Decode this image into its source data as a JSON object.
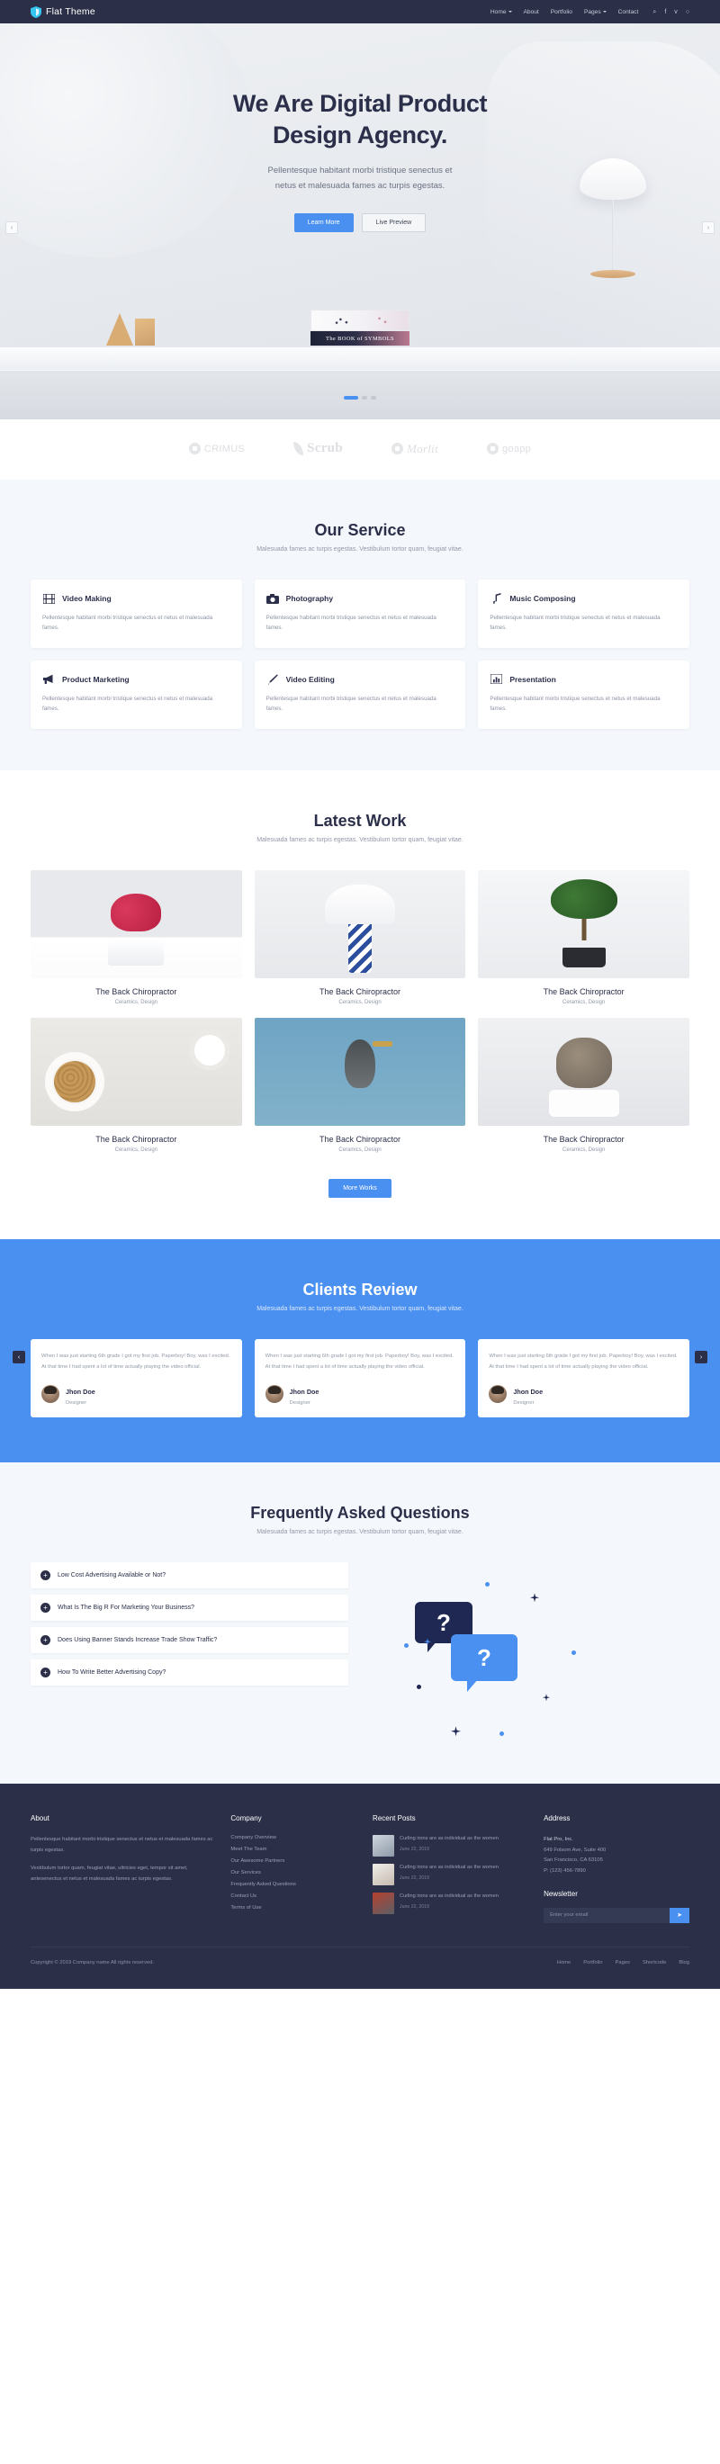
{
  "nav": {
    "brand": "Flat Theme",
    "brand_icon": "shield-icon",
    "links": [
      {
        "label": "Home",
        "caret": true
      },
      {
        "label": "About",
        "caret": false
      },
      {
        "label": "Portfolio",
        "caret": false
      },
      {
        "label": "Pages",
        "caret": true
      },
      {
        "label": "Contact",
        "caret": false
      }
    ],
    "icons": [
      {
        "name": "search-icon",
        "glyph": "⌕"
      },
      {
        "name": "facebook-icon",
        "glyph": "f"
      },
      {
        "name": "twitter-icon",
        "glyph": "ᴠ"
      },
      {
        "name": "github-icon",
        "glyph": "○"
      }
    ]
  },
  "hero": {
    "title_line1": "We Are Digital Product",
    "title_line2": "Design Agency.",
    "subtitle_line1": "Pellentesque habitant morbi tristique senectus et",
    "subtitle_line2": "netus et malesuada fames ac turpis egestas.",
    "primary_btn": "Learn More",
    "secondary_btn": "Live Preview",
    "prev_arrow": "‹",
    "next_arrow": "›",
    "book_title": "The BOOK of SYMBOLS"
  },
  "clients": [
    {
      "name": "CRIMUS",
      "mark": "circle-logo-icon"
    },
    {
      "name": "Scrub",
      "mark": "feather-logo-icon"
    },
    {
      "name": "Morlit",
      "mark": "m-logo-icon"
    },
    {
      "name": "goapp",
      "mark": "play-logo-icon"
    }
  ],
  "services": {
    "title": "Our Service",
    "subtitle": "Malesuada fames ac turpis egestas. Vestibulum tortor quam, feugiat vitae.",
    "items": [
      {
        "icon": "film-icon",
        "name": "Video Making",
        "desc": "Pellentesque habitant morbi tristique senectus et netus et malesuada fames."
      },
      {
        "icon": "camera-icon",
        "name": "Photography",
        "desc": "Pellentesque habitant morbi tristique senectus et netus et malesuada fames."
      },
      {
        "icon": "music-note-icon",
        "name": "Music Composing",
        "desc": "Pellentesque habitant morbi tristique senectus et netus et malesuada fames."
      },
      {
        "icon": "megaphone-icon",
        "name": "Product Marketing",
        "desc": "Pellentesque habitant morbi tristique senectus et netus et malesuada fames."
      },
      {
        "icon": "pen-icon",
        "name": "Video Editing",
        "desc": "Pellentesque habitant morbi tristique senectus et netus et malesuada fames."
      },
      {
        "icon": "bar-chart-icon",
        "name": "Presentation",
        "desc": "Pellentesque habitant morbi tristique senectus et netus et malesuada fames."
      }
    ]
  },
  "portfolio": {
    "title": "Latest Work",
    "subtitle": "Malesuada fames ac turpis egestas. Vestibulum tortor quam, feugiat vitae.",
    "items": [
      {
        "title": "The Back Chiropractor",
        "tags": "Ceramics, Design",
        "art": "t1"
      },
      {
        "title": "The Back Chiropractor",
        "tags": "Ceramics, Design",
        "art": "t2"
      },
      {
        "title": "The Back Chiropractor",
        "tags": "Ceramics, Design",
        "art": "t3"
      },
      {
        "title": "The Back Chiropractor",
        "tags": "Ceramics, Design",
        "art": "t4"
      },
      {
        "title": "The Back Chiropractor",
        "tags": "Ceramics, Design",
        "art": "t5"
      },
      {
        "title": "The Back Chiropractor",
        "tags": "Ceramics, Design",
        "art": "t6"
      }
    ],
    "more_button": "More Works"
  },
  "reviews": {
    "title": "Clients Review",
    "subtitle": "Malesuada fames ac turpis egestas. Vestibulum tortor quam, feugiat vitae.",
    "prev_arrow": "‹",
    "next_arrow": "›",
    "items": [
      {
        "text": "When I was just starting 6th grade I got my first job. Paperboy! Boy, was I excited. At that time I had spent a lot of time actually playing the video official.",
        "name": "Jhon Doe",
        "role": "Designer"
      },
      {
        "text": "When I was just starting 6th grade I got my first job. Paperboy! Boy, was I excited. At that time I had spent a lot of time actually playing the video official.",
        "name": "Jhon Doe",
        "role": "Designer"
      },
      {
        "text": "When I was just starting 6th grade I got my first job. Paperboy! Boy, was I excited. At that time I had spent a lot of time actually playing the video official.",
        "name": "Jhon Doe",
        "role": "Designer"
      }
    ]
  },
  "faq": {
    "title": "Frequently Asked Questions",
    "subtitle": "Malesuada fames ac turpis egestas. Vestibulum tortor quam, feugiat vitae.",
    "plus": "+",
    "items": [
      {
        "question": "Low Cost Advertising Available or Not?"
      },
      {
        "question": "What Is The Big R For Marketing Your Business?"
      },
      {
        "question": "Does Using Banner Stands Increase Trade Show Traffic?"
      },
      {
        "question": "How To Write Better Advertising Copy?"
      }
    ],
    "bubble_glyph": "?"
  },
  "footer": {
    "about": {
      "title": "About",
      "p1": "Pellentesque habitant morbi tristique senectus et netus et malesuada fames ac turpis egestas.",
      "p2": "Vestibulum tortor quam, feugiat vitae, ultricies eget, tempor sit amet, antesenectus et netus et malesuada fames ac turpis egestas."
    },
    "company": {
      "title": "Company",
      "links": [
        "Company Overview",
        "Meet The Team",
        "Our Awesome Partners",
        "Our Services",
        "Frequently Asked Questions",
        "Contact Us",
        "Terms of Use"
      ]
    },
    "posts": {
      "title": "Recent Posts",
      "items": [
        {
          "text": "Curling irons are as individual as the women",
          "date": "June 22, 2019",
          "thumb": "p1"
        },
        {
          "text": "Curling irons are as individual as the women",
          "date": "June 22, 2019",
          "thumb": "p2"
        },
        {
          "text": "Curling irons are as individual as the women",
          "date": "June 22, 2019",
          "thumb": "p3"
        }
      ]
    },
    "address": {
      "title": "Address",
      "company": "Flat Pro, Inc.",
      "street": "649 Folsom Ave, Suite 400",
      "city": "San Francisco, CA 63105",
      "phone": "P: (123) 456-7890"
    },
    "newsletter": {
      "title": "Newsletter",
      "placeholder": "Enter your email",
      "value": "",
      "send_icon": "➤"
    },
    "bottom": {
      "copyright": "Copyright © 2019 Company name All rights reserved.",
      "links": [
        "Home",
        "Portfolio",
        "Pages",
        "Shortcode",
        "Blog"
      ]
    }
  },
  "colors": {
    "accent": "#4a90f0",
    "dark": "#2b2f47",
    "soft_bg": "#f4f7fb",
    "muted_text": "#9298a8"
  }
}
